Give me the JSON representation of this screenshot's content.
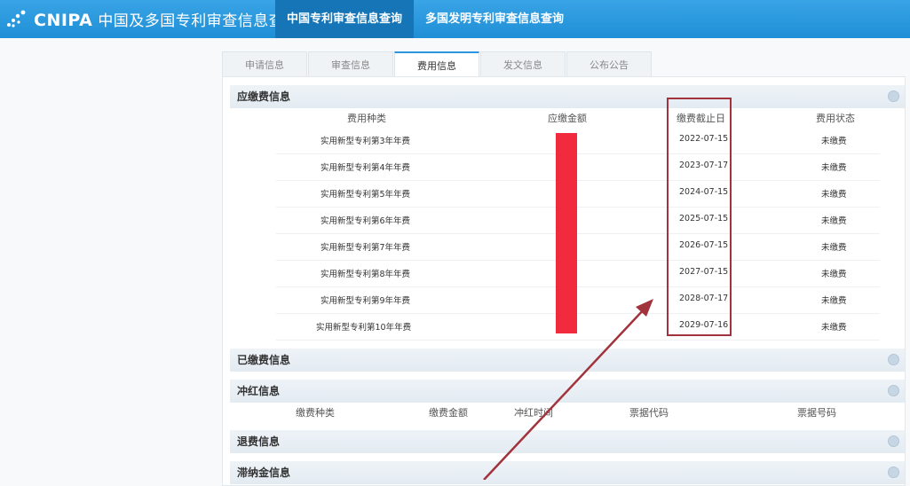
{
  "header": {
    "logo_text": "CNIPA",
    "logo_subtitle": "中国及多国专利审查信息查询",
    "nav": [
      "中国专利审查信息查询",
      "多国发明专利审查信息查询"
    ]
  },
  "tabs": [
    "申请信息",
    "审查信息",
    "费用信息",
    "发文信息",
    "公布公告"
  ],
  "payable_fees": {
    "title": "应缴费信息",
    "columns": [
      "费用种类",
      "应缴金额",
      "缴费截止日",
      "费用状态"
    ],
    "rows": [
      {
        "type": "实用新型专利第3年年费",
        "deadline": "2022-07-15",
        "status": "未缴费"
      },
      {
        "type": "实用新型专利第4年年费",
        "deadline": "2023-07-17",
        "status": "未缴费"
      },
      {
        "type": "实用新型专利第5年年费",
        "deadline": "2024-07-15",
        "status": "未缴费"
      },
      {
        "type": "实用新型专利第6年年费",
        "deadline": "2025-07-15",
        "status": "未缴费"
      },
      {
        "type": "实用新型专利第7年年费",
        "deadline": "2026-07-15",
        "status": "未缴费"
      },
      {
        "type": "实用新型专利第8年年费",
        "deadline": "2027-07-15",
        "status": "未缴费"
      },
      {
        "type": "实用新型专利第9年年费",
        "deadline": "2028-07-17",
        "status": "未缴费"
      },
      {
        "type": "实用新型专利第10年年费",
        "deadline": "2029-07-16",
        "status": "未缴费"
      }
    ]
  },
  "paid_fees": {
    "title": "已缴费信息"
  },
  "reversal": {
    "title": "冲红信息",
    "columns": [
      "缴费种类",
      "缴费金额",
      "冲红时间",
      "票据代码",
      "票据号码"
    ]
  },
  "refund": {
    "title": "退费信息"
  },
  "late_fee": {
    "title": "滞纳金信息"
  },
  "colors": {
    "header_blue": "#2d95df",
    "redaction": "#f22a3e",
    "highlight_box": "#a2333c",
    "arrow": "#a2333c"
  }
}
